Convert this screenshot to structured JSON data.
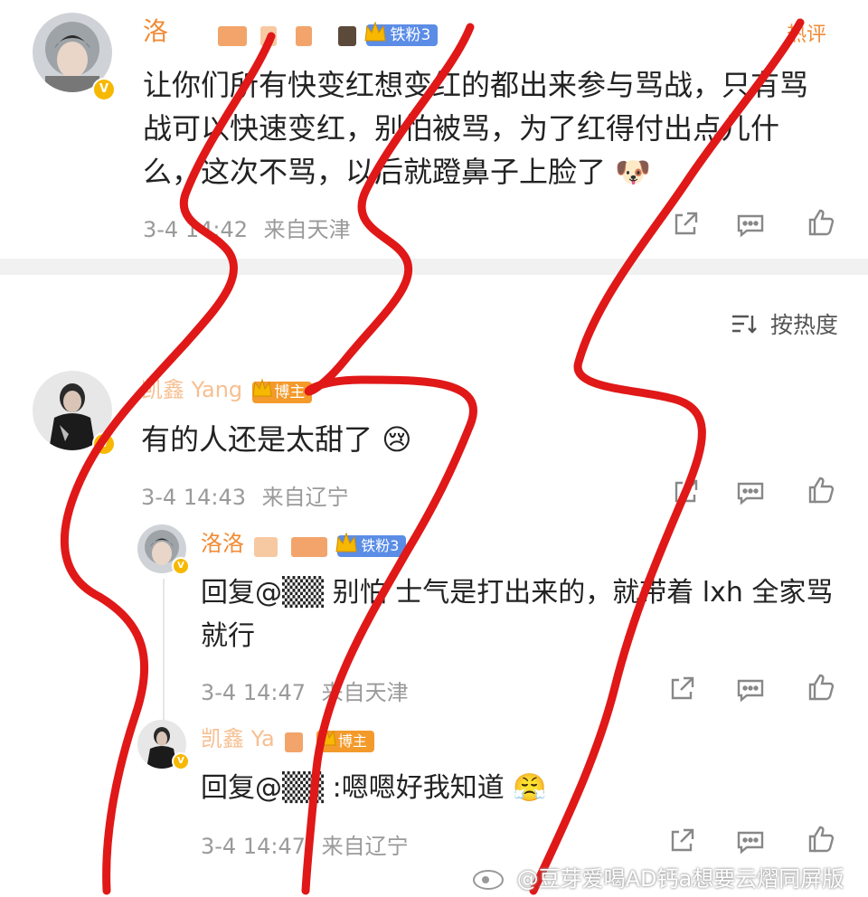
{
  "top_comment": {
    "username": "洛",
    "fan_badge": "铁粉3",
    "hot_label": "热评",
    "content": "让你们所有快变红想变红的都出来参与骂战，只有骂战可以快速变红，别怕被骂，为了红得付出点儿什么，这次不骂，以后就蹬鼻子上脸了",
    "emoji": "🐶",
    "time": "3-4 14:42",
    "location": "来自天津"
  },
  "sort": {
    "label": "按热度"
  },
  "second_comment": {
    "username": "凯鑫 Yang",
    "blogger_badge": "博主",
    "content": "有的人还是太甜了",
    "emoji": "😢",
    "time": "3-4 14:43",
    "location": "来自辽宁"
  },
  "replies": [
    {
      "username": "洛洛",
      "fan_badge": "铁粉3",
      "content": "回复@▒▒ 别怕 士气是打出来的，就带着 lxh 全家骂就行",
      "time": "3-4 14:47",
      "location": "来自天津"
    },
    {
      "username": "凯鑫 Ya",
      "blogger_badge": "博主",
      "content": "回复@▒▒ :嗯嗯好我知道",
      "emoji": "😤",
      "time": "3-4 14:47",
      "location": "来自辽宁"
    }
  ],
  "watermark": "@豆芽爱喝AD钙a想要云熠同屏版",
  "colors": {
    "username": "#f08c37",
    "fan_badge": "#5b8de6",
    "blogger_badge": "#f39a2b",
    "verified": "#f6b800",
    "scribble": "#e01818"
  },
  "icons": [
    "share-icon",
    "comment-icon",
    "like-icon",
    "sort-icon",
    "verified-badge-icon",
    "weibo-logo-icon"
  ]
}
